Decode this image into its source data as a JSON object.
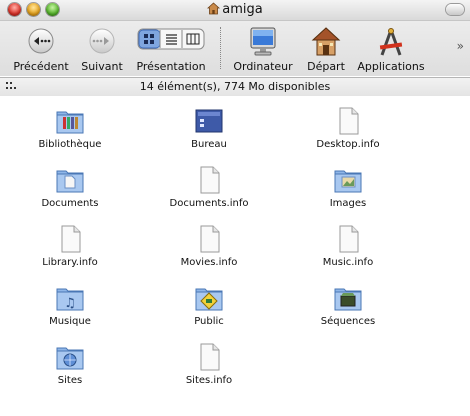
{
  "window": {
    "title": "amiga"
  },
  "toolbar": {
    "back_label": "Précédent",
    "forward_label": "Suivant",
    "view_label": "Présentation",
    "computer_label": "Ordinateur",
    "home_label": "Départ",
    "applications_label": "Applications"
  },
  "status": {
    "text": "14 élément(s), 774 Mo disponibles"
  },
  "files": [
    {
      "name": "Bibliothèque",
      "icon": "library-folder-icon"
    },
    {
      "name": "Bureau",
      "icon": "desktop-folder-icon"
    },
    {
      "name": "Desktop.info",
      "icon": "document-icon"
    },
    {
      "name": "Documents",
      "icon": "documents-folder-icon"
    },
    {
      "name": "Documents.info",
      "icon": "document-icon"
    },
    {
      "name": "Images",
      "icon": "pictures-folder-icon"
    },
    {
      "name": "Library.info",
      "icon": "document-icon"
    },
    {
      "name": "Movies.info",
      "icon": "document-icon"
    },
    {
      "name": "Music.info",
      "icon": "document-icon"
    },
    {
      "name": "Musique",
      "icon": "music-folder-icon"
    },
    {
      "name": "Public",
      "icon": "public-folder-icon"
    },
    {
      "name": "Séquences",
      "icon": "movies-folder-icon"
    },
    {
      "name": "Sites",
      "icon": "sites-folder-icon"
    },
    {
      "name": "Sites.info",
      "icon": "document-icon"
    }
  ]
}
